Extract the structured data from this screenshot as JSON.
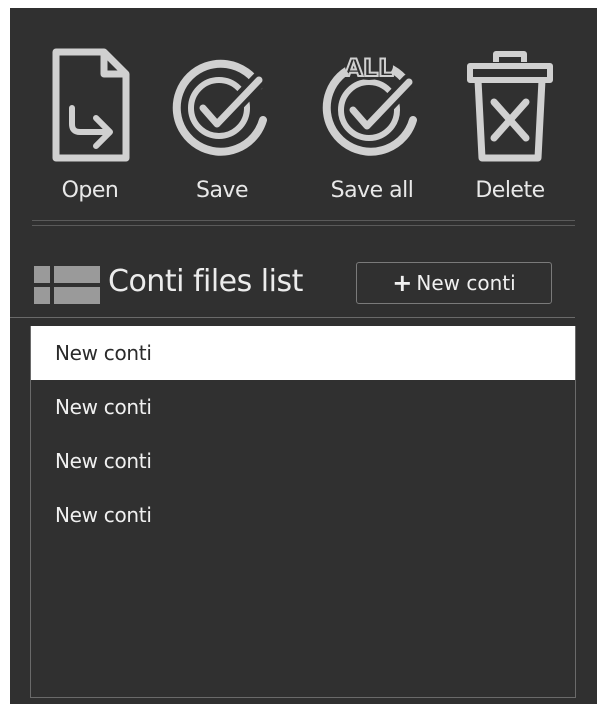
{
  "toolbar": {
    "open": {
      "label": "Open",
      "icon": "open-file-icon"
    },
    "save": {
      "label": "Save",
      "icon": "save-check-icon"
    },
    "save_all": {
      "label": "Save all",
      "icon": "save-all-check-icon",
      "badge": "ALL"
    },
    "delete": {
      "label": "Delete",
      "icon": "trash-icon"
    }
  },
  "list_header": {
    "icon": "list-icon",
    "title": "Conti files list",
    "new_button": {
      "icon": "plus",
      "label": "New conti"
    }
  },
  "files": [
    {
      "name": "New conti",
      "selected": true
    },
    {
      "name": "New conti",
      "selected": false
    },
    {
      "name": "New conti",
      "selected": false
    },
    {
      "name": "New conti",
      "selected": false
    }
  ],
  "colors": {
    "panel_bg": "#303030",
    "icon_stroke": "#d8d8d8",
    "text": "#f0f0f0",
    "selected_bg": "#ffffff",
    "selected_text": "#2a2a2a"
  }
}
